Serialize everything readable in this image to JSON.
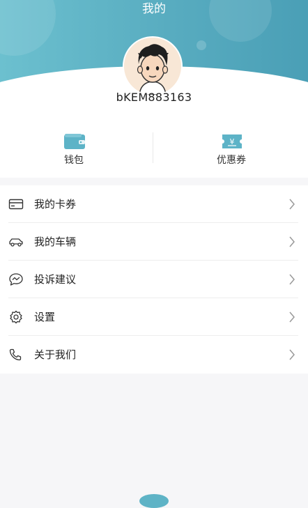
{
  "header": {
    "title": "我的"
  },
  "profile": {
    "username": "bKEM883163",
    "avatar_icon": "cartoon-boy-avatar"
  },
  "quick_actions": [
    {
      "label": "钱包",
      "icon": "wallet-icon"
    },
    {
      "label": "优惠券",
      "icon": "coupon-icon"
    }
  ],
  "menu": {
    "items": [
      {
        "label": "我的卡券",
        "icon": "card-icon"
      },
      {
        "label": "我的车辆",
        "icon": "car-icon"
      },
      {
        "label": "投诉建议",
        "icon": "chat-bubble-icon"
      },
      {
        "label": "设置",
        "icon": "gear-icon"
      },
      {
        "label": "关于我们",
        "icon": "phone-icon"
      }
    ]
  },
  "colors": {
    "header_start": "#6cc0cf",
    "header_end": "#4a9fb6",
    "accent_icon": "#5db3c7",
    "background": "#f6f6f8"
  }
}
